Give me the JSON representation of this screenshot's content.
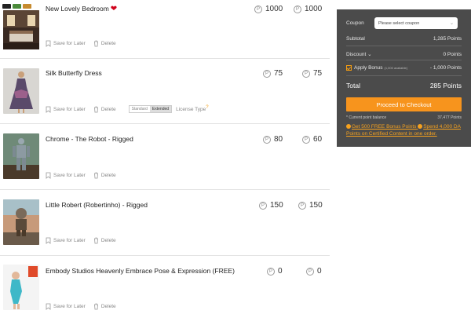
{
  "cart": {
    "items": [
      {
        "title": "New Lovely Bedroom",
        "price_original": "1000",
        "price_final": "1000",
        "save_label": "Save for Later",
        "delete_label": "Delete"
      },
      {
        "title": "Silk Butterfly Dress",
        "price_original": "75",
        "price_final": "75",
        "save_label": "Save for Later",
        "delete_label": "Delete",
        "license": {
          "options": [
            "Standard",
            "Extended"
          ],
          "selected": "Extended",
          "label": "License Type",
          "help": "?"
        }
      },
      {
        "title": "Chrome - The Robot - Rigged",
        "price_original": "80",
        "price_final": "60",
        "save_label": "Save for Later",
        "delete_label": "Delete"
      },
      {
        "title": "Little Robert (Robertinho) - Rigged",
        "price_original": "150",
        "price_final": "150",
        "save_label": "Save for Later",
        "delete_label": "Delete"
      },
      {
        "title": "Embody Studios Heavenly Embrace Pose & Expression (FREE)",
        "price_original": "0",
        "price_final": "0",
        "save_label": "Save for Later",
        "delete_label": "Delete"
      }
    ],
    "points_symbol": "P"
  },
  "summary": {
    "coupon_label": "Coupon",
    "coupon_placeholder": "Please select coupon",
    "subtotal_label": "Subtotal",
    "subtotal_value": "1,285 Points",
    "discount_label": "Discount",
    "discount_value": "0 Points",
    "bonus_label": "Apply Bonus",
    "bonus_note": "(1,000 available)",
    "bonus_value": "- 1,000 Points",
    "total_label": "Total",
    "total_value": "285 Points",
    "checkout_label": "Proceed to Checkout",
    "balance_label": "* Current point balance",
    "balance_value": "37,477 Points",
    "promo_1": "Get 500 FREE Bonus Points",
    "promo_2": "Spend 4,000 DA Points on Certified Content in one order."
  },
  "colors": {
    "accent": "#f7941d",
    "summary_bg": "#4b4b4b",
    "heart": "#d0021b"
  }
}
